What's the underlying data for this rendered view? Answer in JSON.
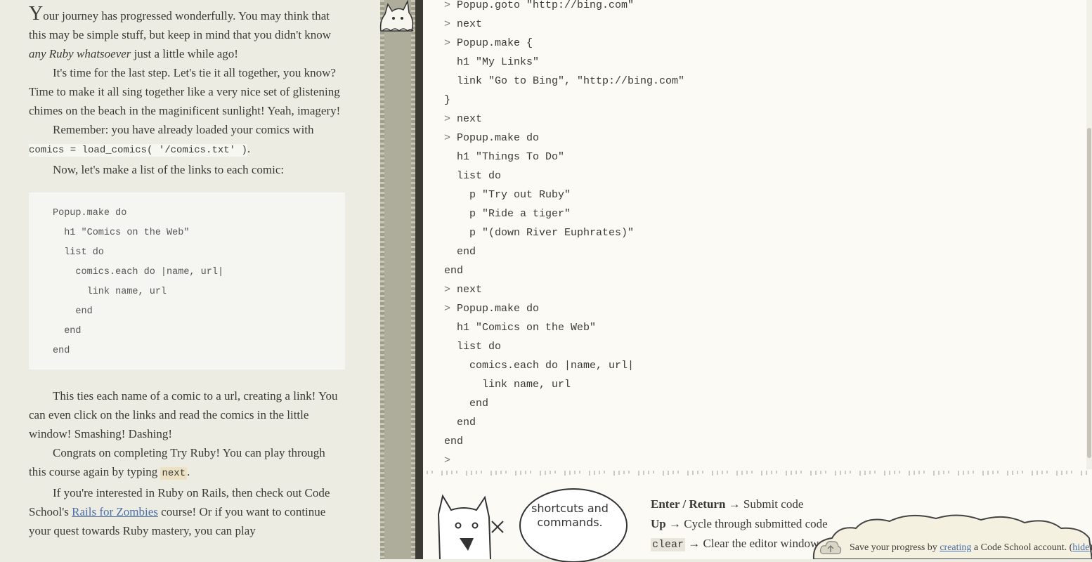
{
  "lesson": {
    "p1_dropcap": "Y",
    "p1_a": "our journey has progressed wonderfully. You may think that this may be simple stuff, but keep in mind that you didn't know ",
    "p1_em": "any Ruby whatsoever",
    "p1_b": " just a little while ago!",
    "p2": "It's time for the last step. Let's tie it all together, you know? Time to make it all sing together like a very nice set of glistening chimes on the beach in the maginificent sunlight! Yeah, imagery!",
    "p3_a": "Remember: you have already loaded your comics with ",
    "p3_code": "comics = load_comics( '/comics.txt' )",
    "p3_b": ".",
    "p4": "Now, let's make a list of the links to each comic:",
    "code_block": "Popup.make do\n  h1 \"Comics on the Web\"\n  list do\n    comics.each do |name, url|\n      link name, url\n    end\n  end\nend",
    "p5": "This ties each name of a comic to a url, creating a link! You can even click on the links and read the comics in the little window! Smashing! Dashing!",
    "p6_a": "Congrats on completing Try Ruby! You can play through this course again by typing ",
    "p6_code": "next",
    "p6_b": ".",
    "p7_a": "If you're interested in Ruby on Rails, then check out Code School's ",
    "p7_link": "Rails for Zombies",
    "p7_b": " course! Or if you want to continue your quest towards Ruby mastery, you can play"
  },
  "console": {
    "lines": [
      "> Popup.goto \"http://bing.com\"",
      "> next",
      "> Popup.make {",
      "  h1 \"My Links\"",
      "  link \"Go to Bing\", \"http://bing.com\"",
      "}",
      "> next",
      "> Popup.make do",
      "  h1 \"Things To Do\"",
      "  list do",
      "    p \"Try out Ruby\"",
      "    p \"Ride a tiger\"",
      "    p \"(down River Euphrates)\"",
      "  end",
      "end",
      "> next",
      "> Popup.make do",
      "  h1 \"Comics on the Web\"",
      "  list do",
      "    comics.each do |name, url|",
      "      link name, url",
      "    end",
      "  end",
      "end",
      ">"
    ]
  },
  "shortcuts": {
    "bubble_text": "shortcuts and commands.",
    "items": [
      {
        "key": "Enter / Return",
        "arrow": "→",
        "desc": "Submit code"
      },
      {
        "key": "Up",
        "arrow": "→",
        "desc": "Cycle through submitted code"
      },
      {
        "key": "clear",
        "arrow": "→",
        "desc": "Clear the editor window"
      }
    ]
  },
  "save_banner": {
    "text_a": "Save your progress by ",
    "link": "creating",
    "text_b": " a Code School account. (",
    "hide": "hide",
    "text_c": ")"
  },
  "colors": {
    "lesson_bg": "#edece3",
    "console_bg": "#fbfaf5",
    "link": "#4c6fa8",
    "divider_dark": "#3b3a33"
  }
}
